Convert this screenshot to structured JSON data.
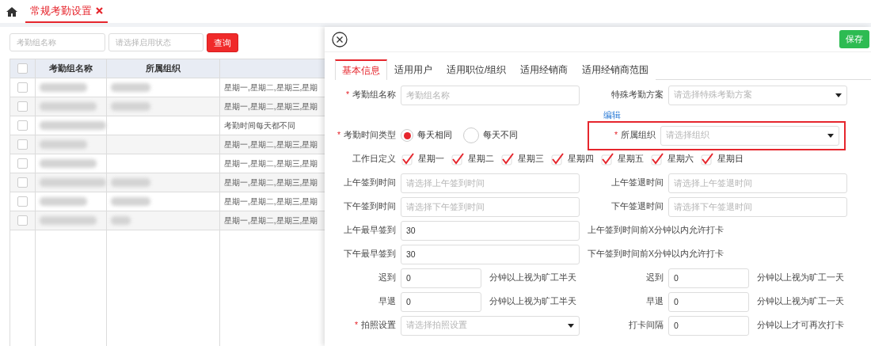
{
  "top_tabs": [
    {
      "label": "常规考勤设置",
      "selected": true,
      "closable": true
    }
  ],
  "filters": {
    "name_placeholder": "考勤组名称",
    "status_placeholder": "请选择启用状态",
    "search_button": "查询"
  },
  "table": {
    "all_checked": false,
    "columns": [
      "考勤组名称",
      "所属组织"
    ],
    "rows": [
      {
        "checked": false,
        "name_redacted": true,
        "org_redacted": true,
        "column_3": "星期一,星期二,星期三,星期"
      },
      {
        "checked": false,
        "name_redacted": true,
        "org_redacted": true,
        "column_3": "星期一,星期二,星期三,星期"
      },
      {
        "checked": false,
        "name_redacted": true,
        "org_redacted": false,
        "column_3": "考勤时间每天都不同"
      },
      {
        "checked": false,
        "name_redacted": true,
        "org_redacted": false,
        "column_3": "星期一,星期二,星期三,星期"
      },
      {
        "checked": false,
        "name_redacted": true,
        "org_redacted": false,
        "column_3": "星期一,星期二,星期三,星期"
      },
      {
        "checked": false,
        "name_redacted": true,
        "org_redacted": true,
        "column_3": "星期一,星期二,星期三,星期"
      },
      {
        "checked": false,
        "name_redacted": true,
        "org_redacted": true,
        "column_3": "星期一,星期二,星期三,星期"
      },
      {
        "checked": false,
        "name_redacted": true,
        "org_redacted": true,
        "column_3": "星期一,星期二,星期三,星期"
      }
    ]
  },
  "panel": {
    "save_button": "保存",
    "tabs": [
      {
        "label": "基本信息",
        "selected": true
      },
      {
        "label": "适用用户",
        "selected": false
      },
      {
        "label": "适用职位/组织",
        "selected": false
      },
      {
        "label": "适用经销商",
        "selected": false
      },
      {
        "label": "适用经销商范围",
        "selected": false
      }
    ],
    "rows": [
      {
        "left": {
          "kind": "input",
          "label": "考勤组名称",
          "required_mark": "*",
          "placeholder": "考勤组名称"
        },
        "right": {
          "kind": "select",
          "label": "特殊考勤方案",
          "placeholder": "请选择特殊考勤方案"
        }
      },
      {
        "right": {
          "kind": "link",
          "text": "编辑"
        }
      },
      {
        "left": {
          "kind": "radios",
          "label": "考勤时间类型",
          "required_mark": "*",
          "options": [
            {
              "label": "每天相同",
              "selected": true
            },
            {
              "label": "每天不同",
              "selected": false
            }
          ]
        },
        "right": {
          "kind": "select",
          "label": "所属组织",
          "required_mark": "*",
          "placeholder": "请选择组织",
          "highlighted": true
        }
      },
      {
        "left": {
          "kind": "checks",
          "label": "工作日定义",
          "options": [
            {
              "label": "星期一",
              "checked": true
            },
            {
              "label": "星期二",
              "checked": true
            },
            {
              "label": "星期三",
              "checked": true
            },
            {
              "label": "星期四",
              "checked": true
            },
            {
              "label": "星期五",
              "checked": true
            },
            {
              "label": "星期六",
              "checked": true
            },
            {
              "label": "星期日",
              "checked": true
            }
          ]
        }
      },
      {
        "left": {
          "kind": "input",
          "label": "上午签到时间",
          "placeholder": "请选择上午签到时间"
        },
        "right": {
          "kind": "input",
          "label": "上午签退时间",
          "placeholder": "请选择上午签退时间"
        }
      },
      {
        "left": {
          "kind": "input",
          "label": "下午签到时间",
          "placeholder": "请选择下午签到时间"
        },
        "right": {
          "kind": "input",
          "label": "下午签退时间",
          "placeholder": "请选择下午签退时间"
        }
      },
      {
        "left": {
          "kind": "input",
          "label": "上午最早签到",
          "value": "30",
          "suffix": "上午签到时间前X分钟以内允许打卡"
        }
      },
      {
        "left": {
          "kind": "input",
          "label": "下午最早签到",
          "value": "30",
          "suffix": "下午签到时间前X分钟以内允许打卡"
        }
      },
      {
        "left": {
          "kind": "number",
          "label": "迟到",
          "value": "0",
          "suffix": "分钟以上视为旷工半天"
        },
        "right": {
          "kind": "number",
          "label": "迟到",
          "value": "0",
          "suffix": "分钟以上视为旷工一天"
        }
      },
      {
        "left": {
          "kind": "number",
          "label": "早退",
          "value": "0",
          "suffix": "分钟以上视为旷工半天"
        },
        "right": {
          "kind": "number",
          "label": "早退",
          "value": "0",
          "suffix": "分钟以上视为旷工一天"
        }
      },
      {
        "left": {
          "kind": "select",
          "label": "拍照设置",
          "required_mark": "*",
          "placeholder": "请选择拍照设置"
        },
        "right": {
          "kind": "number",
          "label": "打卡间隔",
          "value": "0",
          "suffix": "分钟以上才可再次打卡"
        }
      }
    ]
  }
}
